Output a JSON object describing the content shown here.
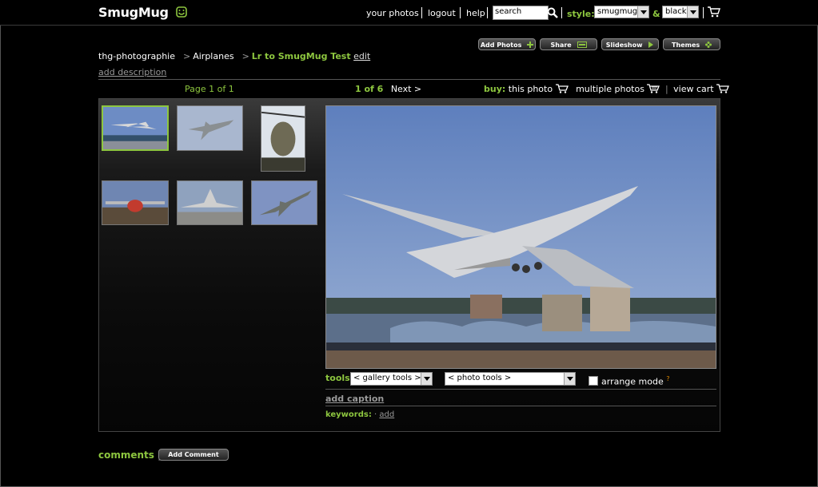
{
  "header": {
    "logo": "SmugMug",
    "nav": [
      "your photos",
      "logout",
      "help"
    ],
    "search_value": "search",
    "style_label": "style:",
    "style_select": "smugmug",
    "amp": "&",
    "color_select": "black"
  },
  "actions": [
    {
      "label": "Add Photos"
    },
    {
      "label": "Share"
    },
    {
      "label": "Slideshow"
    },
    {
      "label": "Themes"
    }
  ],
  "breadcrumb": {
    "user": "thg-photographie",
    "category": "Airplanes",
    "gallery": "Lr to SmugMug Test",
    "edit": "edit",
    "sep": ">"
  },
  "add_description": "add description",
  "pager": {
    "page": "Page 1 of 1",
    "photo_count": "1 of 6",
    "next": "Next >",
    "buy_label": "buy:",
    "this_photo": "this photo",
    "multiple_photos": "multiple photos",
    "view_cart": "view cart"
  },
  "tools": {
    "label": "tools:",
    "gallery_tools": "< gallery tools >",
    "photo_tools": "< photo tools >",
    "arrange_mode": "arrange mode",
    "help_mark": "?",
    "add_caption": "add caption",
    "keywords_label": "keywords:",
    "keywords_sep": "·",
    "keywords_add": "add"
  },
  "comments": {
    "label": "comments",
    "add_comment": "Add Comment"
  },
  "colors": {
    "accent": "#8dc63f",
    "background": "#000000"
  }
}
